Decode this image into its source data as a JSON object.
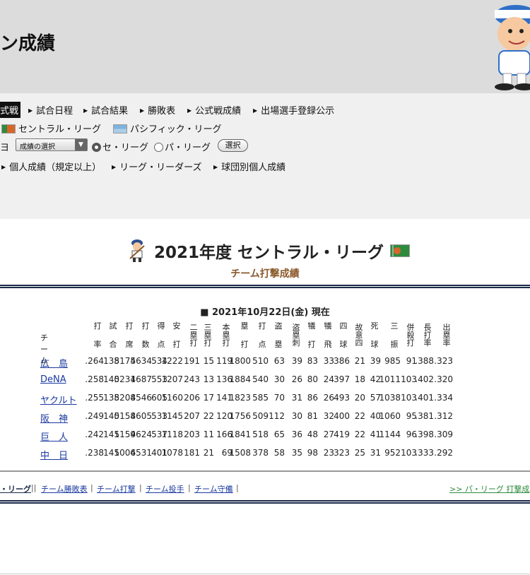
{
  "header": {
    "title": "ン成績"
  },
  "nav": {
    "current": "式戦",
    "links": [
      "試合日程",
      "試合結果",
      "勝敗表",
      "公式戦成績",
      "出場選手登録公示"
    ],
    "leagues": [
      "セントラル・リーグ",
      "パシフィック・リーグ"
    ],
    "select_label": "成績の選択",
    "left_stub": "ヨ",
    "radio_central": "セ・リーグ",
    "radio_pacific": "パ・リーグ",
    "select_button": "選択",
    "subnav": [
      "個人成績（規定以上）",
      "リーグ・リーダーズ",
      "球団別個人成績"
    ]
  },
  "content": {
    "title": "2021年度 セントラル・リーグ",
    "subtitle": "チーム打撃成績",
    "date": "■ 2021年10月22日(金) 現在"
  },
  "table": {
    "team_header": "チーム",
    "headers": [
      [
        "打",
        "率"
      ],
      [
        "試",
        "合"
      ],
      [
        "打",
        "席"
      ],
      [
        "打",
        "数"
      ],
      [
        "得",
        "点"
      ],
      [
        "安",
        "打"
      ],
      [
        "二",
        "塁",
        "打"
      ],
      [
        "三",
        "塁",
        "打"
      ],
      [
        "本",
        "塁",
        "打"
      ],
      [
        "塁",
        "打"
      ],
      [
        "打",
        "点"
      ],
      [
        "盗",
        "塁"
      ],
      [
        "盗",
        "塁",
        "刺"
      ],
      [
        "犠",
        "打"
      ],
      [
        "犠",
        "飛"
      ],
      [
        "四",
        "球"
      ],
      [
        "故",
        "意",
        "四"
      ],
      [
        "死",
        "球"
      ],
      [
        "三",
        "振"
      ],
      [
        "併",
        "殺",
        "打"
      ],
      [
        "長",
        "打",
        "率"
      ],
      [
        "出",
        "塁",
        "率"
      ]
    ],
    "rows": [
      {
        "team": "広　島",
        "vals": [
          ".264",
          "138",
          "5175",
          "4634",
          "534",
          "1222",
          "191",
          "15",
          "119",
          "1800",
          "510",
          "63",
          "39",
          "83",
          "33",
          "386",
          "21",
          "39",
          "985",
          "91",
          ".388",
          ".323"
        ]
      },
      {
        "team": "DeNA",
        "vals": [
          ".258",
          "140",
          "5231",
          "4687",
          "553",
          "1207",
          "243",
          "13",
          "136",
          "1884",
          "540",
          "30",
          "26",
          "80",
          "24",
          "397",
          "18",
          "42",
          "1011",
          "103",
          ".402",
          ".320"
        ]
      },
      {
        "team": "ヤクルト",
        "vals": [
          ".255",
          "138",
          "5208",
          "4546",
          "605",
          "1160",
          "206",
          "17",
          "141",
          "1823",
          "585",
          "70",
          "31",
          "86",
          "26",
          "493",
          "20",
          "57",
          "1038",
          "103",
          ".401",
          ".334"
        ]
      },
      {
        "team": "阪　神",
        "vals": [
          ".249",
          "140",
          "5158",
          "4605",
          "533",
          "1145",
          "207",
          "22",
          "120",
          "1756",
          "509",
          "112",
          "30",
          "81",
          "32",
          "400",
          "22",
          "40",
          "1060",
          "95",
          ".381",
          ".312"
        ]
      },
      {
        "team": "巨　人",
        "vals": [
          ".242",
          "141",
          "5159",
          "4624",
          "537",
          "1118",
          "203",
          "11",
          "166",
          "1841",
          "518",
          "65",
          "36",
          "48",
          "27",
          "419",
          "22",
          "41",
          "1144",
          "96",
          ".398",
          ".309"
        ]
      },
      {
        "team": "中　日",
        "vals": [
          ".238",
          "141",
          "5006",
          "4531",
          "401",
          "1078",
          "181",
          "21",
          "69",
          "1508",
          "378",
          "58",
          "35",
          "98",
          "23",
          "323",
          "25",
          "31",
          "952",
          "103",
          ".333",
          ".292"
        ]
      }
    ]
  },
  "footer": {
    "current": "・リーグ",
    "links": [
      "チーム勝敗表",
      "チーム打撃",
      "チーム投手",
      "チーム守備"
    ],
    "right_link": ">> パ・リーグ 打撃成"
  },
  "colors": {
    "header_bg": "#dcdcdc",
    "nav_bg": "#f0f0f0",
    "link": "#1a3aa0",
    "subtitle": "#8b5a2b",
    "pacific_link": "#2e8b3e"
  }
}
